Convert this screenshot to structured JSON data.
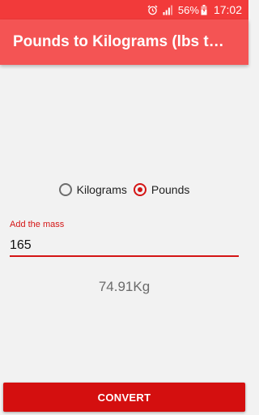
{
  "status_bar": {
    "battery_percent": "56%",
    "time": "17:02",
    "icons": [
      "alarm-icon",
      "signal-icon",
      "battery-charging-icon"
    ]
  },
  "toolbar": {
    "title": "Pounds to Kilograms (lbs to kg)"
  },
  "unit_options": [
    {
      "label": "Kilograms",
      "checked": false
    },
    {
      "label": "Pounds",
      "checked": true
    }
  ],
  "mass_field": {
    "label": "Add the mass",
    "value": "165"
  },
  "result": {
    "text": "74.91Kg"
  },
  "convert_button": {
    "label": "CONVERT"
  },
  "colors": {
    "status_bar": "#f23a3a",
    "toolbar": "#f45454",
    "accent": "#d41515",
    "button": "#d40f0f",
    "background": "#f2f2f2"
  }
}
